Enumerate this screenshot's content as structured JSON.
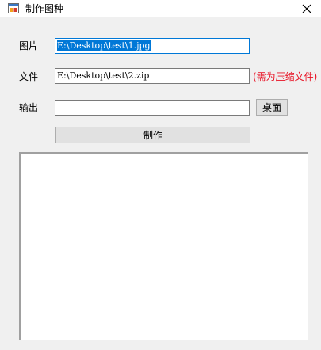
{
  "window": {
    "title": "制作图种",
    "app_icon": "window-form-icon",
    "close_icon": "close-icon"
  },
  "form": {
    "image_label": "图片",
    "image_value": "E:\\Desktop\\test\\1.jpg",
    "file_label": "文件",
    "file_value": "E:\\Desktop\\test\\2.zip",
    "file_hint": "(需为压缩文件)",
    "output_label": "输出",
    "output_value": "",
    "desktop_button": "桌面",
    "make_button": "制作"
  },
  "log": {
    "content": ""
  },
  "colors": {
    "hint": "#e81123",
    "selection": "#0078d7",
    "window_bg": "#f0f0f0"
  }
}
